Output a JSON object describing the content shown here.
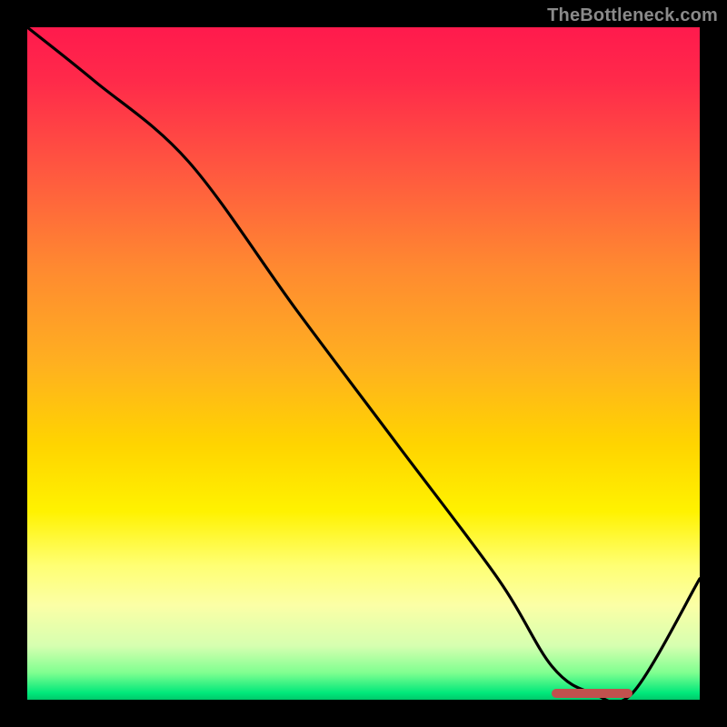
{
  "watermark": "TheBottleneck.com",
  "chart_data": {
    "type": "line",
    "title": "",
    "xlabel": "",
    "ylabel": "",
    "xlim": [
      0,
      100
    ],
    "ylim": [
      0,
      100
    ],
    "grid": false,
    "legend": false,
    "series": [
      {
        "name": "bottleneck-curve",
        "x": [
          0,
          10,
          24,
          40,
          55,
          70,
          78,
          84,
          90,
          100
        ],
        "y": [
          100,
          92,
          80,
          58,
          38,
          18,
          5,
          1,
          1,
          18
        ]
      }
    ],
    "marker": {
      "name": "optimal-range",
      "x_start": 78,
      "x_end": 90,
      "y": 1
    },
    "background_gradient": {
      "top": "#ff1a4d",
      "mid": "#ffd400",
      "bottom": "#00c96a"
    }
  }
}
